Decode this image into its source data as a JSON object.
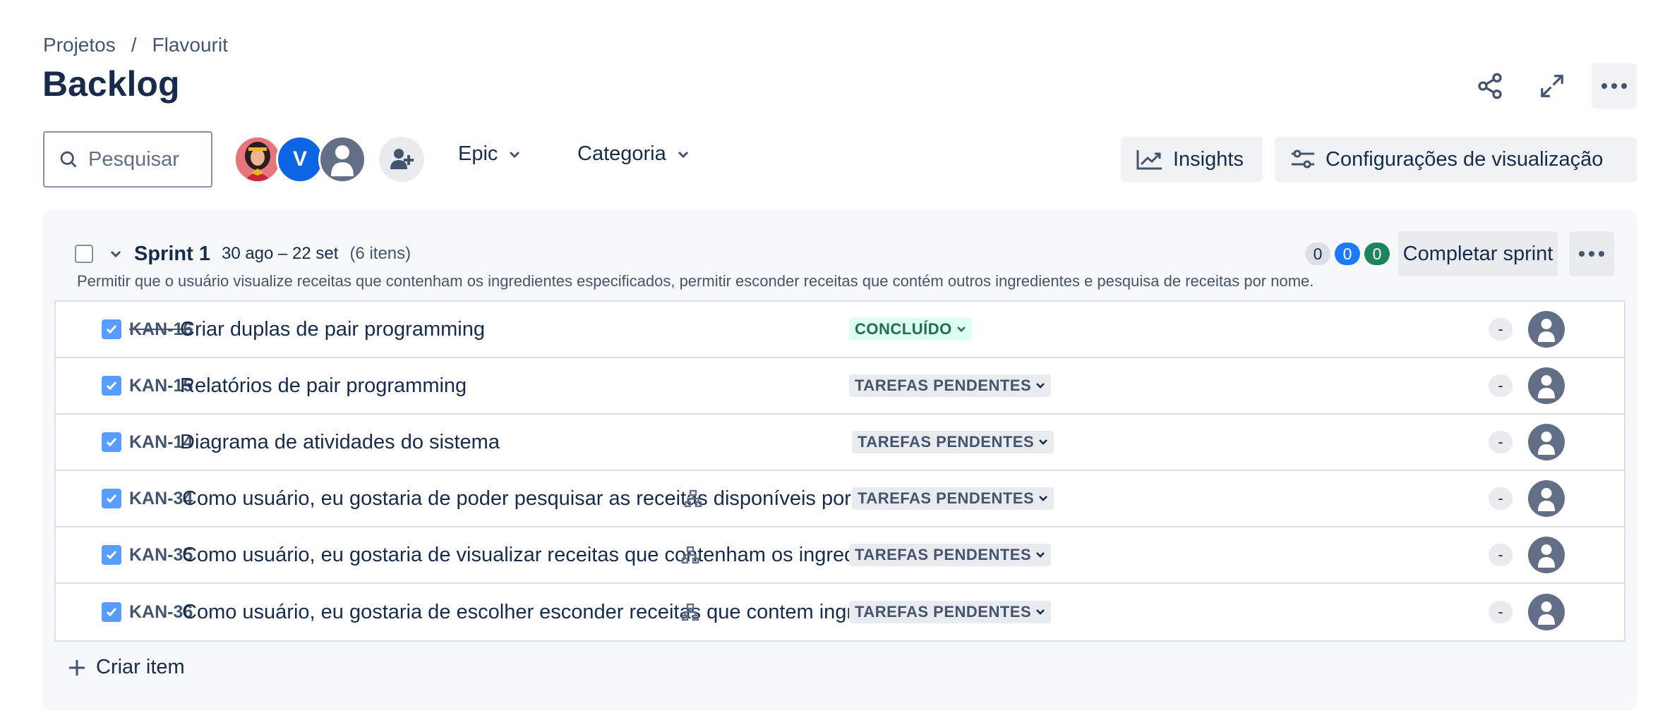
{
  "breadcrumb": {
    "root": "Projetos",
    "separator": "/",
    "project": "Flavourit"
  },
  "page": {
    "title": "Backlog"
  },
  "toolbar": {
    "search_placeholder": "Pesquisar",
    "avatar_v_initial": "V",
    "filter_epic": "Epic",
    "filter_category": "Categoria",
    "insights_label": "Insights",
    "view_settings_label": "Configurações de visualização"
  },
  "sprint": {
    "name": "Sprint 1",
    "dates": "30 ago – 22 set",
    "item_count": "(6 itens)",
    "counts": {
      "todo": "0",
      "in_progress": "0",
      "done": "0"
    },
    "complete_label": "Completar sprint",
    "description": "Permitir que o usuário visualize receitas que contenham os ingredientes especificados, permitir esconder receitas que contém outros ingredientes e pesquisa de receitas por nome.",
    "issues": [
      {
        "key": "KAN-16",
        "summary": "Criar duplas de pair programming",
        "status": "CONCLUÍDO",
        "estimate": "-",
        "done": true,
        "has_child": false
      },
      {
        "key": "KAN-15",
        "summary": "Relatórios de pair programming",
        "status": "TAREFAS PENDENTES",
        "estimate": "-",
        "done": false,
        "has_child": false
      },
      {
        "key": "KAN-14",
        "summary": "Diagrama de atividades do sistema",
        "status": "TAREFAS PENDENTES",
        "estimate": "-",
        "done": false,
        "has_child": false
      },
      {
        "key": "KAN-34",
        "summary": "Como usuário, eu gostaria de poder pesquisar as receitas disponíveis por nome.",
        "status": "TAREFAS PENDENTES",
        "estimate": "-",
        "done": false,
        "has_child": true
      },
      {
        "key": "KAN-35",
        "summary": "Como usuário, eu gostaria de visualizar receitas que contenham os ingredientes e...",
        "status": "TAREFAS PENDENTES",
        "estimate": "-",
        "done": false,
        "has_child": true
      },
      {
        "key": "KAN-36",
        "summary": "Como usuário, eu gostaria de escolher esconder receitas que contem ingredientes...",
        "status": "TAREFAS PENDENTES",
        "estimate": "-",
        "done": false,
        "has_child": true
      }
    ],
    "create_label": "Criar item"
  },
  "colors": {
    "accent": "#0c66e4",
    "checkbox": "#579dff",
    "done_status_bg": "#dcfff1",
    "done_status_fg": "#216e4e"
  }
}
